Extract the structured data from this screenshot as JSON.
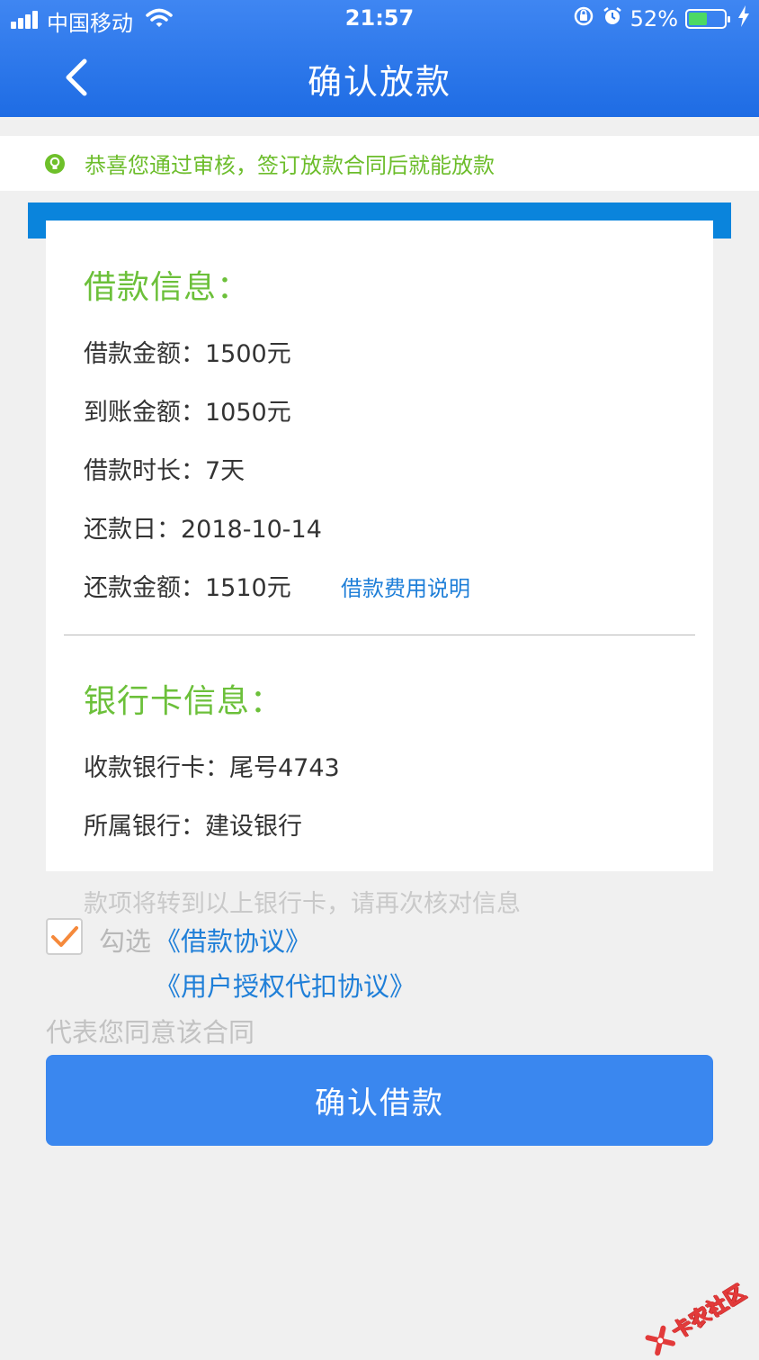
{
  "status_bar": {
    "carrier": "中国移动",
    "time": "21:57",
    "battery_percent": "52%",
    "battery_level": 0.52
  },
  "nav": {
    "title": "确认放款",
    "back_icon": "chevron-left-icon"
  },
  "tip": {
    "icon": "lightbulb-icon",
    "text": "恭喜您通过审核，签订放款合同后就能放款"
  },
  "loan_info": {
    "title": "借款信息：",
    "rows": [
      "借款金额：1500元",
      "到账金额：1050元",
      "借款时长：7天",
      "还款日：2018-10-14",
      "还款金额：1510元"
    ],
    "fee_link": "借款费用说明"
  },
  "bank_info": {
    "title": "银行卡信息：",
    "rows": [
      "收款银行卡：尾号4743",
      "所属银行：建设银行"
    ]
  },
  "notice": "款项将转到以上银行卡，请再次核对信息",
  "agreement": {
    "checked": true,
    "prefix": "勾选",
    "link1": "《借款协议》",
    "link2": "《用户授权代扣协议》",
    "suffix": "代表您同意该合同"
  },
  "confirm_button": "确认借款",
  "watermark": "卡农社区",
  "colors": {
    "header_blue": "#2b78ea",
    "accent_green": "#6cc03a",
    "link_blue": "#1f7fd8",
    "button_blue": "#3a87ef",
    "checkmark_orange": "#f5893b"
  }
}
